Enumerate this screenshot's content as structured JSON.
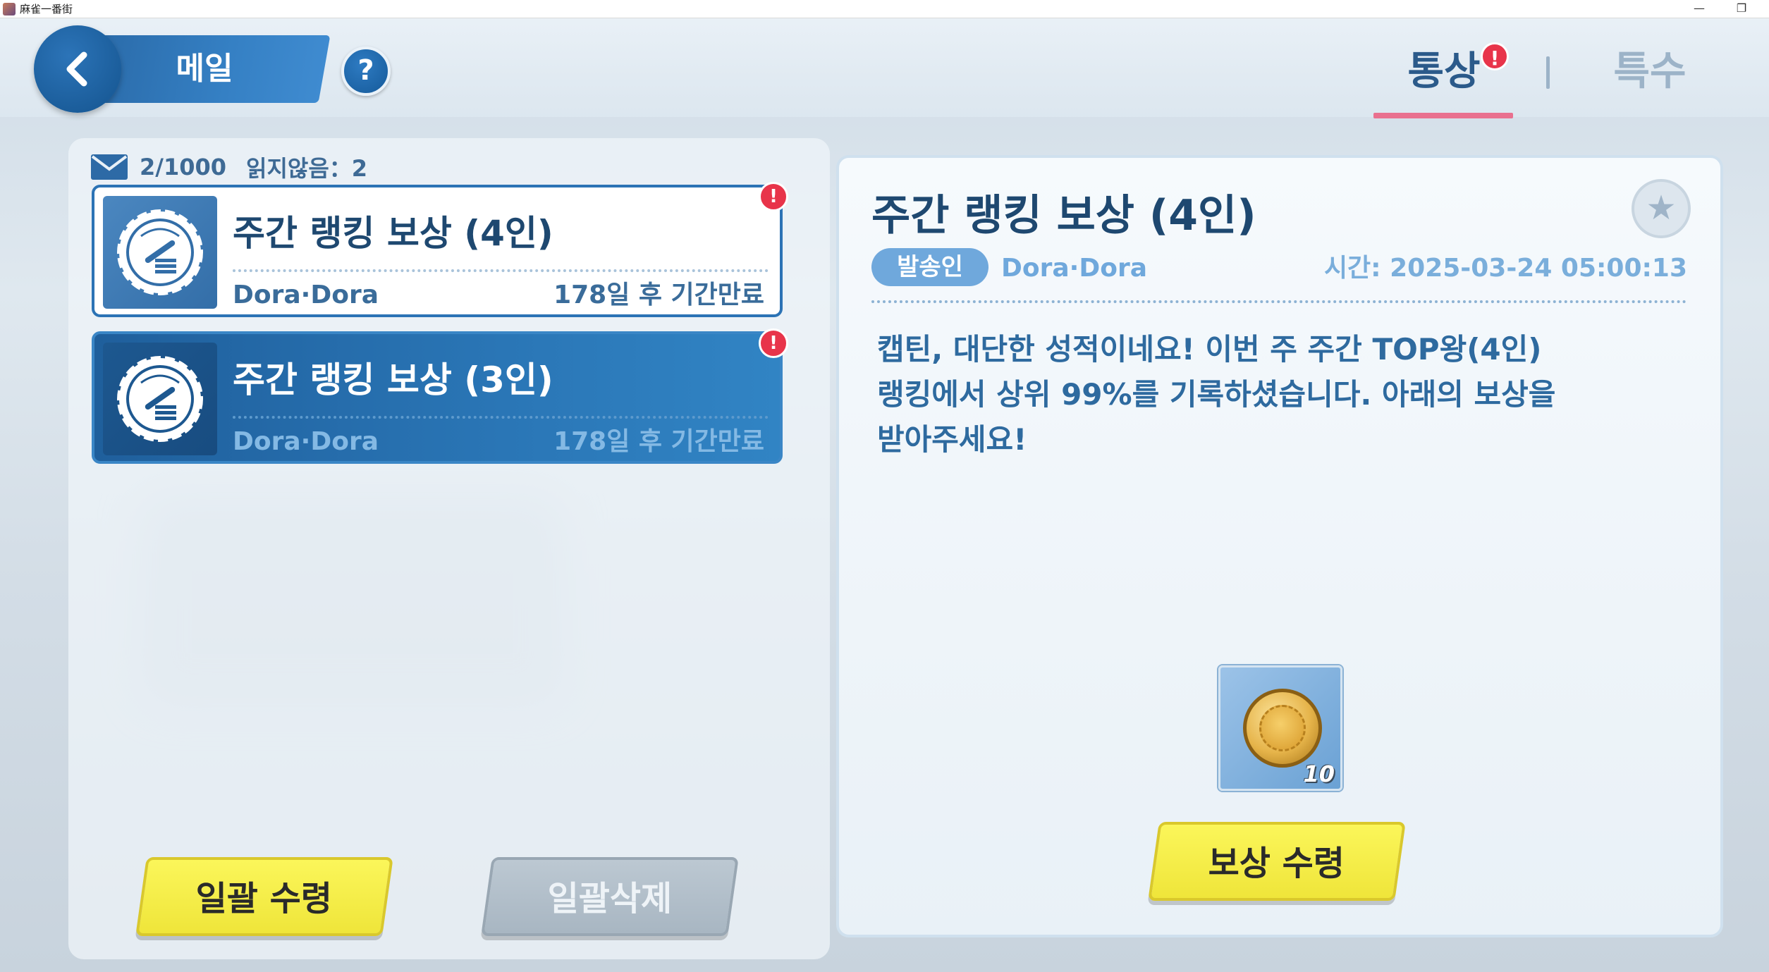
{
  "window": {
    "title": "麻雀一番街",
    "minimize_glyph": "—",
    "maximize_glyph": "❐"
  },
  "header": {
    "title": "메일",
    "help_glyph": "?",
    "tabs": [
      {
        "label": "통상",
        "active": true,
        "badge": "!"
      },
      {
        "label": "특수",
        "active": false
      }
    ]
  },
  "mail_list": {
    "count": "2/1000",
    "unread_label": "읽지않음：2",
    "items": [
      {
        "subject": "주간 랭킹 보상 (4인)",
        "sender": "Dora·Dora",
        "expiry": "178일 후 기간만료",
        "badge": "!",
        "state": "unread",
        "thumb_icon": "reward-badge-icon"
      },
      {
        "subject": "주간 랭킹 보상 (3인)",
        "sender": "Dora·Dora",
        "expiry": "178일 후 기간만료",
        "badge": "!",
        "state": "selected",
        "thumb_icon": "reward-badge-icon"
      }
    ]
  },
  "actions": {
    "claim_all": "일괄 수령",
    "delete_all": "일괄삭제"
  },
  "detail": {
    "title": "주간 랭킹 보상 (4인)",
    "sender_label": "발송인",
    "sender": "Dora·Dora",
    "time": "시간: 2025-03-24  05:00:13",
    "body_lines": [
      "캡틴, 대단한 성적이네요! 이번 주 주간 TOP왕(4인)",
      "랭킹에서 상위 99%를 기록하셨습니다. 아래의 보상을",
      "받아주세요!"
    ],
    "reward": {
      "icon": "gold-coin-icon",
      "quantity": "10"
    },
    "claim_button": "보상 수령",
    "star_glyph": "★"
  },
  "colors": {
    "accent_blue": "#2c73b5",
    "title_text": "#1e4870",
    "badge_red": "#e8344a",
    "button_yellow": "#f5ee4a",
    "tab_underline": "#e9708f"
  }
}
